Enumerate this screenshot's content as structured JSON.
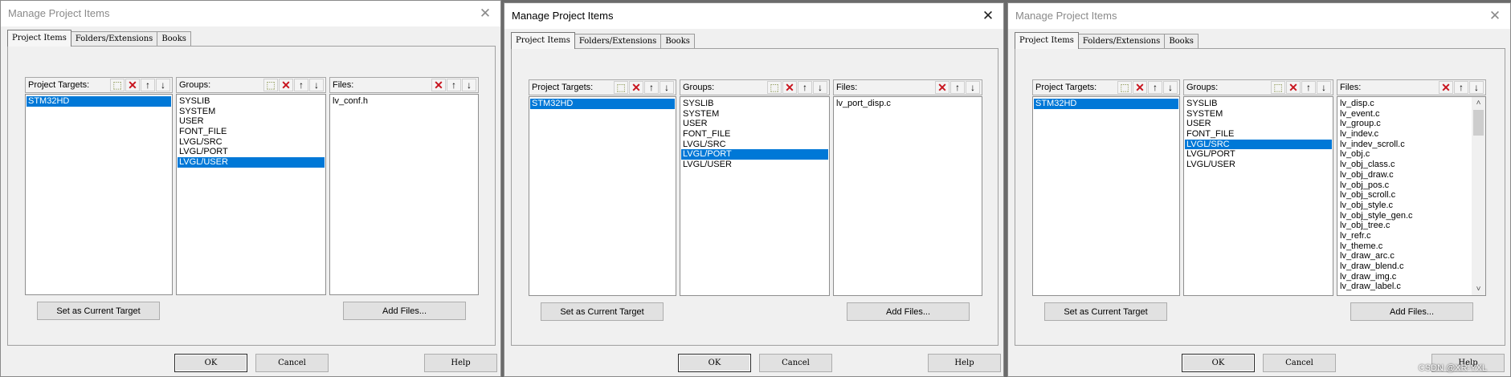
{
  "dialogs": [
    {
      "title": "Manage Project Items",
      "tabs": [
        "Project Items",
        "Folders/Extensions",
        "Books"
      ],
      "targets": {
        "label": "Project Targets:",
        "items": [
          "STM32HD"
        ],
        "selected": 0
      },
      "groups": {
        "label": "Groups:",
        "items": [
          "SYSLIB",
          "SYSTEM",
          "USER",
          "FONT_FILE",
          "LVGL/SRC",
          "LVGL/PORT",
          "LVGL/USER"
        ],
        "selected": 6
      },
      "files": {
        "label": "Files:",
        "items": [
          "lv_conf.h"
        ]
      },
      "set_target_label": "Set as Current Target",
      "add_files_label": "Add Files...",
      "ok_label": "OK",
      "cancel_label": "Cancel",
      "help_label": "Help"
    },
    {
      "title": "Manage Project Items",
      "tabs": [
        "Project Items",
        "Folders/Extensions",
        "Books"
      ],
      "targets": {
        "label": "Project Targets:",
        "items": [
          "STM32HD"
        ],
        "selected": 0
      },
      "groups": {
        "label": "Groups:",
        "items": [
          "SYSLIB",
          "SYSTEM",
          "USER",
          "FONT_FILE",
          "LVGL/SRC",
          "LVGL/PORT",
          "LVGL/USER"
        ],
        "selected": 5
      },
      "files": {
        "label": "Files:",
        "items": [
          "lv_port_disp.c"
        ]
      },
      "set_target_label": "Set as Current Target",
      "add_files_label": "Add Files...",
      "ok_label": "OK",
      "cancel_label": "Cancel",
      "help_label": "Help"
    },
    {
      "title": "Manage Project Items",
      "tabs": [
        "Project Items",
        "Folders/Extensions",
        "Books"
      ],
      "targets": {
        "label": "Project Targets:",
        "items": [
          "STM32HD"
        ],
        "selected": 0
      },
      "groups": {
        "label": "Groups:",
        "items": [
          "SYSLIB",
          "SYSTEM",
          "USER",
          "FONT_FILE",
          "LVGL/SRC",
          "LVGL/PORT",
          "LVGL/USER"
        ],
        "selected": 4
      },
      "files": {
        "label": "Files:",
        "items": [
          "lv_disp.c",
          "lv_event.c",
          "lv_group.c",
          "lv_indev.c",
          "lv_indev_scroll.c",
          "lv_obj.c",
          "lv_obj_class.c",
          "lv_obj_draw.c",
          "lv_obj_pos.c",
          "lv_obj_scroll.c",
          "lv_obj_style.c",
          "lv_obj_style_gen.c",
          "lv_obj_tree.c",
          "lv_refr.c",
          "lv_theme.c",
          "lv_draw_arc.c",
          "lv_draw_blend.c",
          "lv_draw_img.c",
          "lv_draw_label.c"
        ]
      },
      "set_target_label": "Set as Current Target",
      "add_files_label": "Add Files...",
      "ok_label": "OK",
      "cancel_label": "Cancel",
      "help_label": "Help"
    }
  ],
  "icons": {
    "close": "close-icon",
    "new": "new-item-icon",
    "delete": "delete-icon",
    "up": "move-up-icon",
    "down": "move-down-icon"
  },
  "watermark": "CSDN @XR-YXL"
}
